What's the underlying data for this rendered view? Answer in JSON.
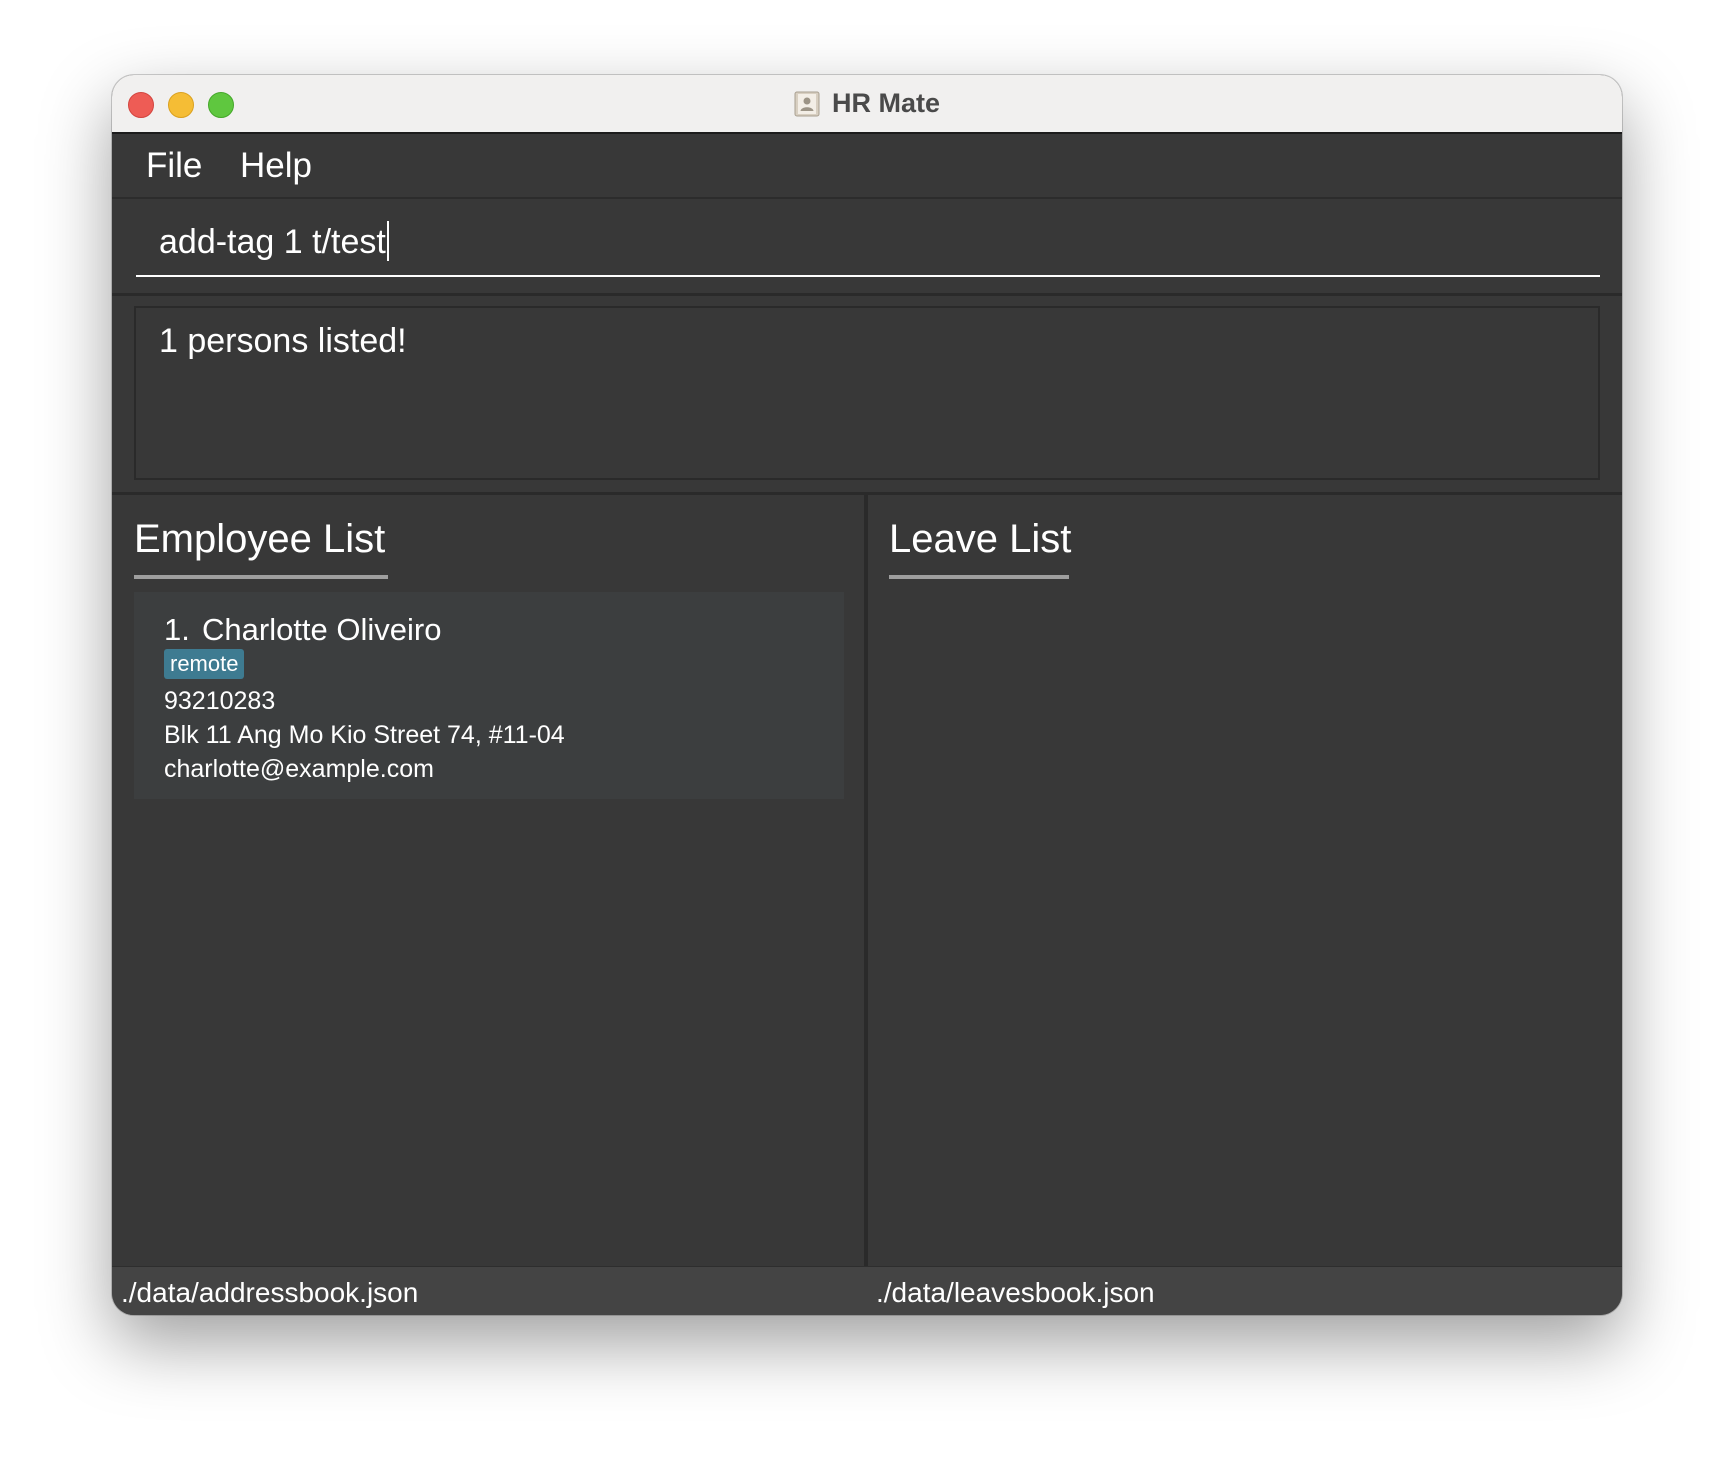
{
  "window": {
    "title": "HR Mate",
    "app_icon": "contact-book-icon"
  },
  "menu": {
    "items": [
      "File",
      "Help"
    ]
  },
  "command_box": {
    "value": "add-tag 1 t/test"
  },
  "result_display": {
    "text": "1 persons listed!"
  },
  "employee_panel": {
    "title": "Employee List",
    "employees": [
      {
        "index": "1.",
        "name": "Charlotte Oliveiro",
        "tags": [
          "remote"
        ],
        "phone": "93210283",
        "address": "Blk 11 Ang Mo Kio Street 74, #11-04",
        "email": "charlotte@example.com"
      }
    ]
  },
  "leave_panel": {
    "title": "Leave List",
    "leaves": []
  },
  "status_bar": {
    "address_book_path": "./data/addressbook.json",
    "leaves_book_path": "./data/leavesbook.json"
  },
  "colors": {
    "background": "#383838",
    "tag": "#3e7b91",
    "card": "#3c3e3f",
    "close": "#ee5c55",
    "minimize": "#f5bd35",
    "maximize": "#5fc73f"
  }
}
